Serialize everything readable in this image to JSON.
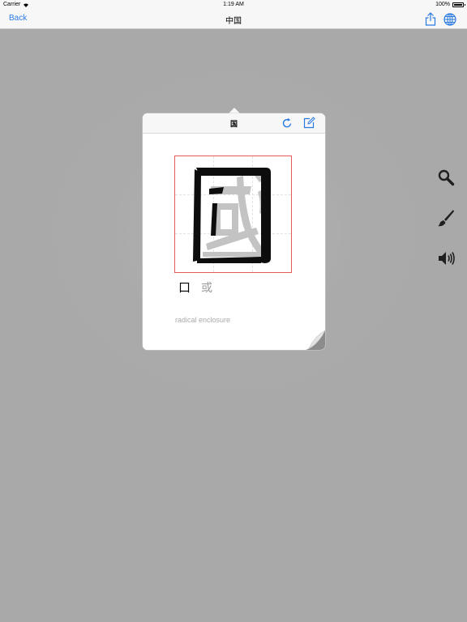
{
  "status_bar": {
    "carrier": "Carrier",
    "time": "1:19 AM",
    "battery": "100%"
  },
  "nav": {
    "back_label": "Back",
    "title": "中国"
  },
  "popover": {
    "title": "国",
    "character": "國",
    "components": {
      "main": "口",
      "secondary": "或"
    },
    "radical_label": "radical  enclosure"
  },
  "colors": {
    "accent": "#2a7ae2",
    "box_border": "#e85a5a",
    "overlay": "#a9a9a9"
  },
  "icons": {
    "share": "share-icon",
    "globe": "globe-icon",
    "refresh": "refresh-icon",
    "edit": "edit-icon",
    "search": "search-icon",
    "brush": "brush-icon",
    "speaker": "speaker-icon",
    "page_curl": "page-curl-icon"
  }
}
